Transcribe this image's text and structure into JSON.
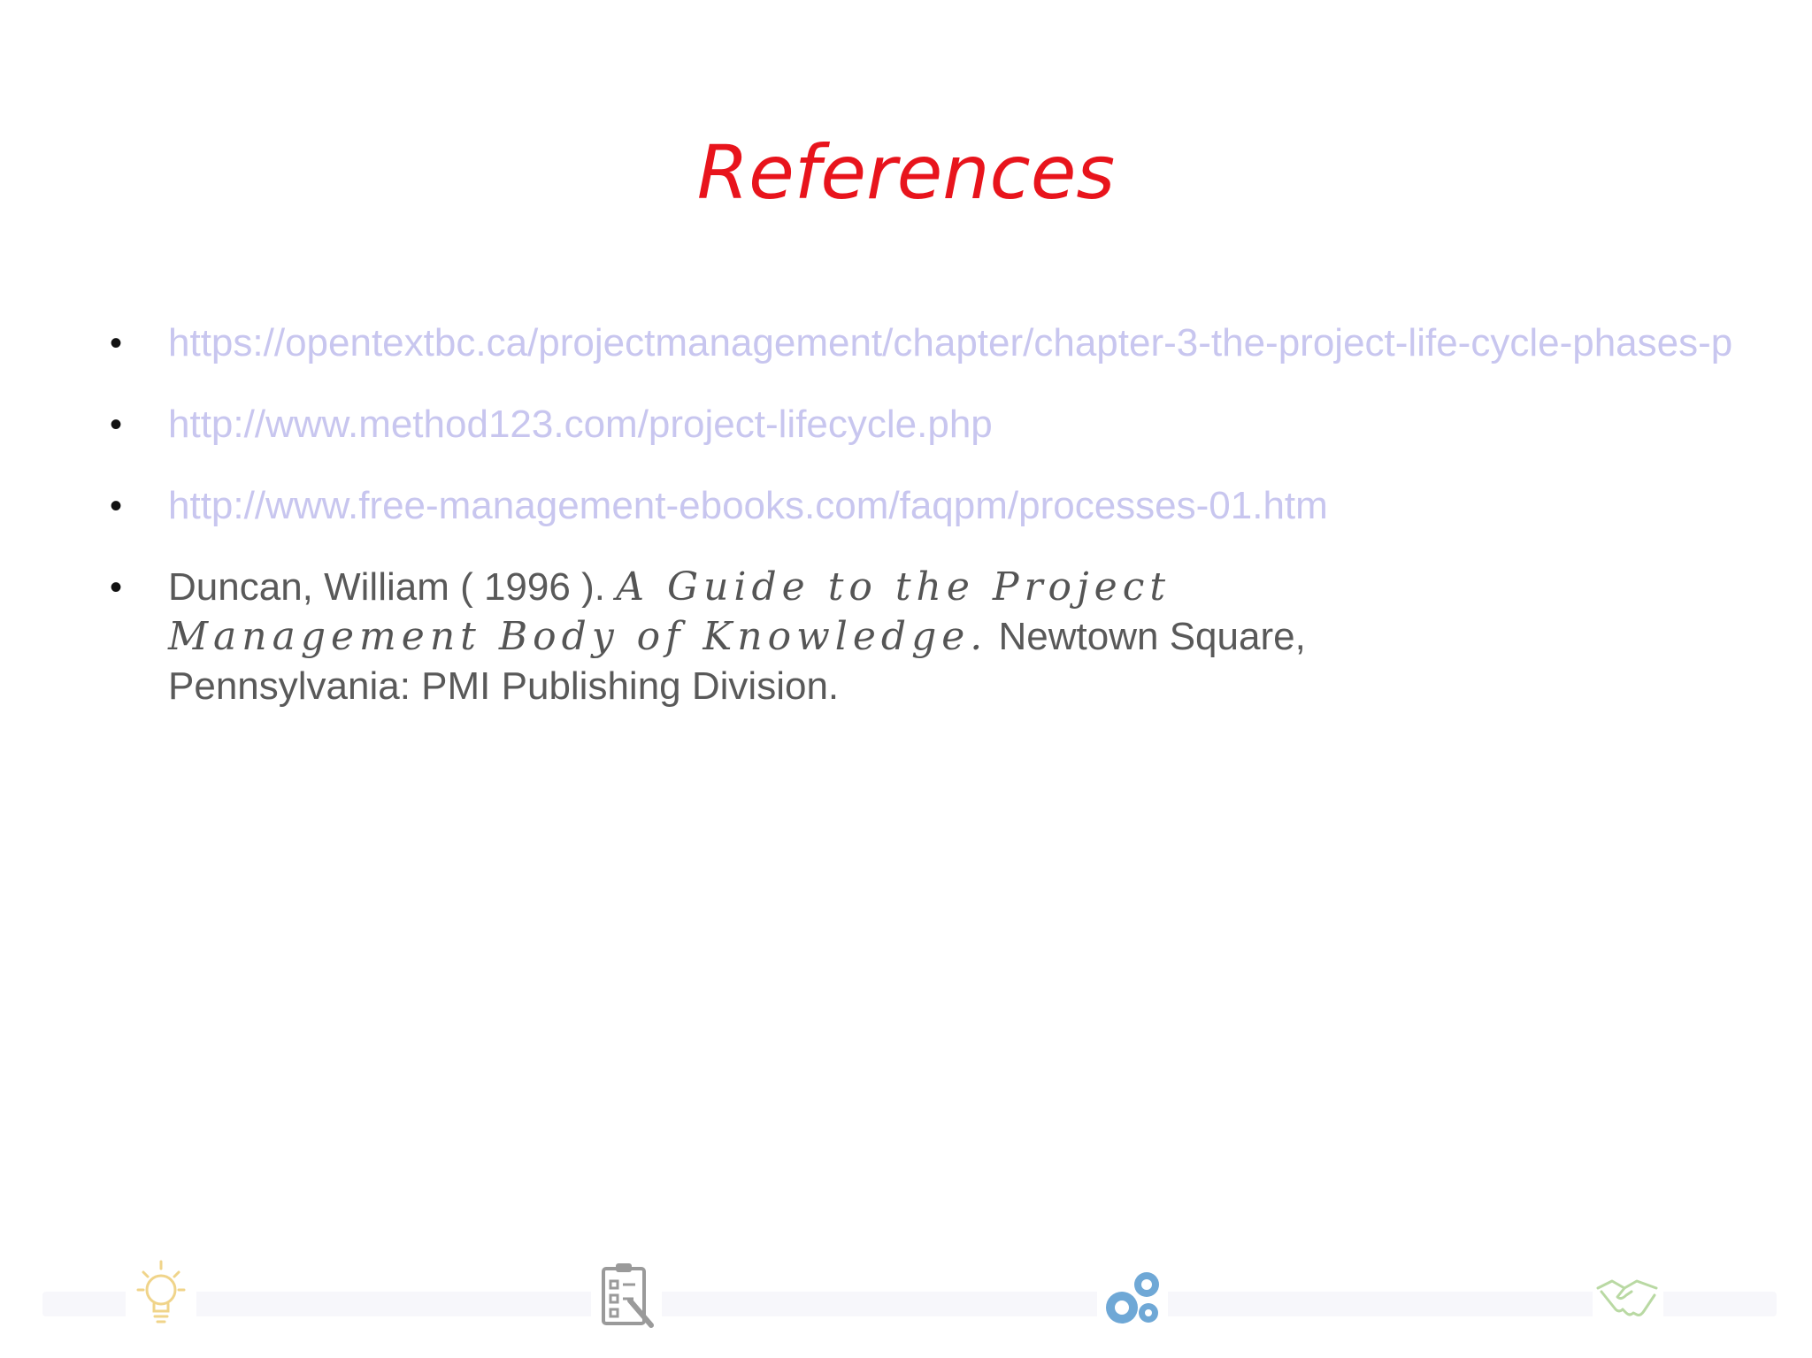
{
  "slide": {
    "title": "References",
    "references": [
      {
        "text": "https://opentextbc.ca/projectmanagement/chapter/chapter-3-the-project-life-cycle-phases-p",
        "kind": "link"
      },
      {
        "text": "http://www.method123.com/project-lifecycle.php",
        "kind": "link"
      },
      {
        "text": "http://www.free-management-ebooks.com/faqpm/processes-01.htm",
        "kind": "link"
      },
      {
        "kind": "citation",
        "author": "Duncan, William ( 1996 ).",
        "book_title": "A Guide to the Project Management Body of Knowledge.",
        "publisher": "Newtown Square, Pennsylvania: PMI Publishing Division."
      }
    ],
    "bullet": "•"
  },
  "footer": {
    "icons": [
      "lightbulb-icon",
      "clipboard-checklist-icon",
      "gears-icon",
      "handshake-icon"
    ],
    "colors": {
      "lightbulb": "#f0d48a",
      "clipboard": "#9a9a9a",
      "gears": "#6fa8d6",
      "handshake": "#b9d9a3"
    }
  },
  "colors": {
    "title": "#e8141c",
    "link": "#c8c6ef",
    "text": "#595959"
  }
}
